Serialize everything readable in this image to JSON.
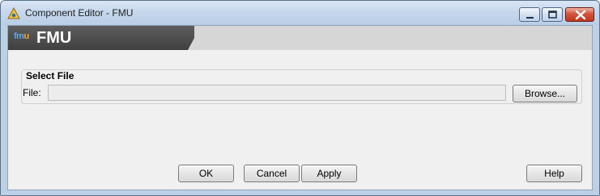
{
  "window": {
    "title": "Component Editor - FMU",
    "icon": "component-editor-icon"
  },
  "title_controls": {
    "minimize_icon": "minimize-icon",
    "maximize_icon": "maximize-icon",
    "close_icon": "close-icon"
  },
  "header": {
    "logo_text_a": "fm",
    "logo_text_b": "u",
    "title": "FMU"
  },
  "select_file": {
    "legend": "Select File",
    "file_label": "File:",
    "file_value": "",
    "browse_label": "Browse..."
  },
  "buttons": {
    "ok": "OK",
    "cancel": "Cancel",
    "apply": "Apply",
    "help": "Help"
  },
  "colors": {
    "title_bar": "#c5d7ec",
    "header_dark": "#4a4a4a",
    "header_light": "#d6d6d6",
    "client_bg": "#f0f0f0",
    "close_button": "#c8412a"
  }
}
